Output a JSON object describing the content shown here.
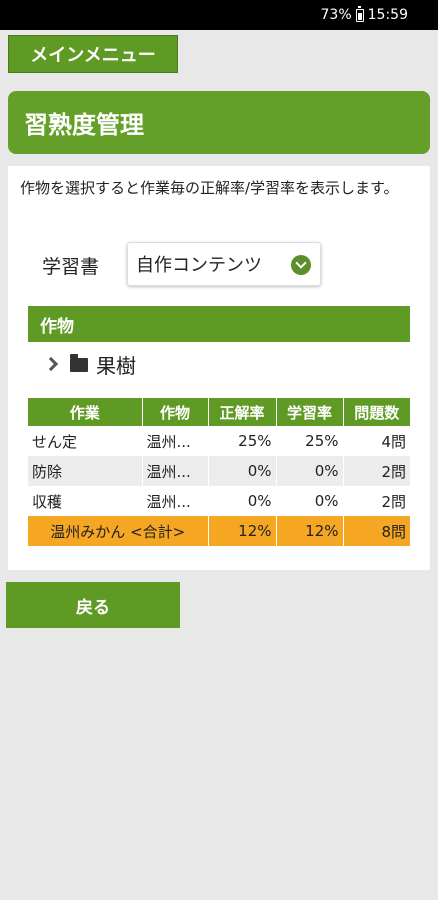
{
  "status": {
    "battery": "73%",
    "time": "15:59"
  },
  "menu_button": "メインメニュー",
  "title": "習熟度管理",
  "description": "作物を選択すると作業毎の正解率/学習率を表示します。",
  "book": {
    "label": "学習書",
    "selected": "自作コンテンツ"
  },
  "crop_section": {
    "header": "作物",
    "tree_item": "果樹"
  },
  "table": {
    "headers": [
      "作業",
      "作物",
      "正解率",
      "学習率",
      "問題数"
    ],
    "rows": [
      [
        "せん定",
        "温州...",
        "25%",
        "25%",
        "4問"
      ],
      [
        "防除",
        "温州...",
        "0%",
        "0%",
        "2問"
      ],
      [
        "収穫",
        "温州...",
        "0%",
        "0%",
        "2問"
      ]
    ],
    "total": {
      "label": "温州みかん <合計>",
      "accuracy": "12%",
      "learning": "12%",
      "count": "8問"
    }
  },
  "back_button": "戻る",
  "colors": {
    "green": "#5f9a24",
    "total_row": "#f5a623"
  }
}
